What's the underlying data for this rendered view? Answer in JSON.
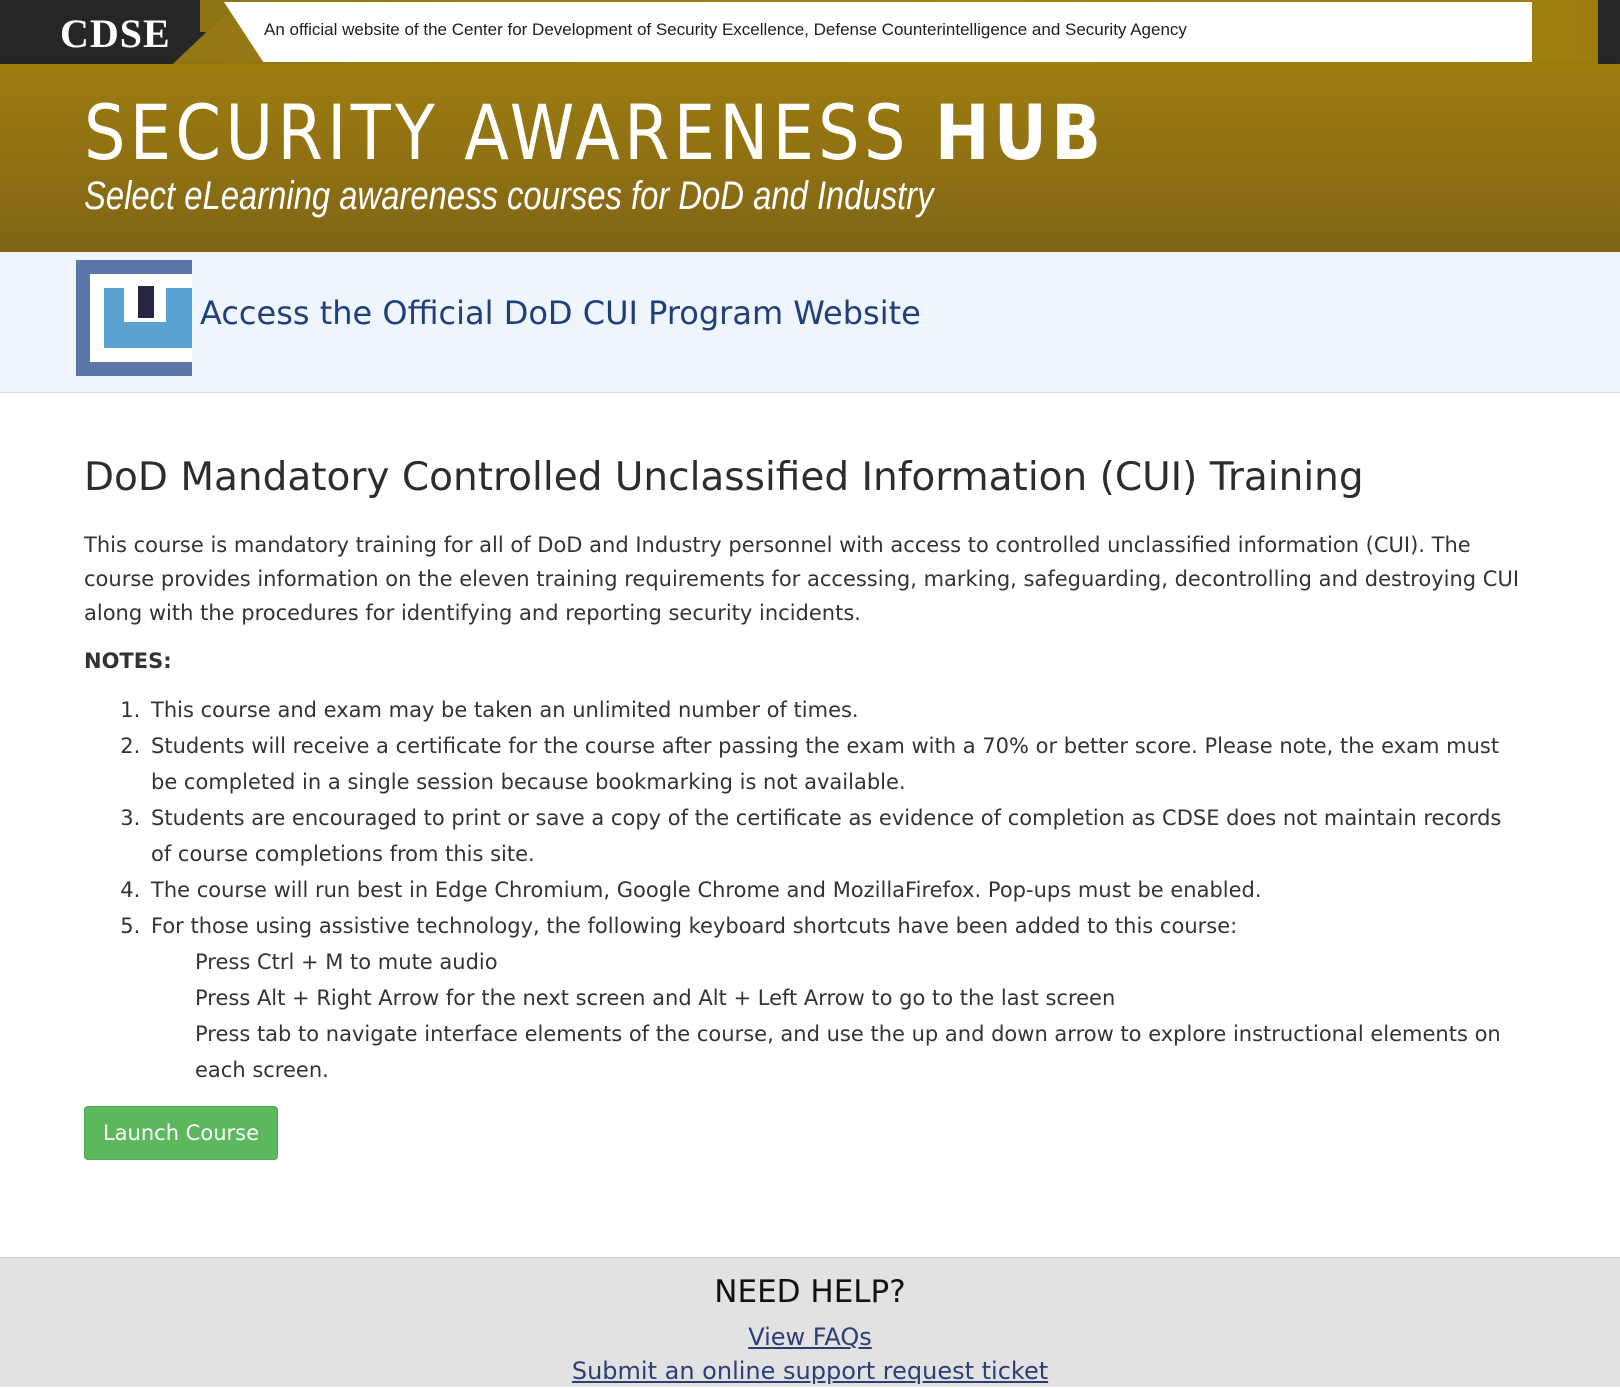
{
  "topbar": {
    "logo_text": "CDSE",
    "official_notice": "An official website of the Center for Development of Security Excellence, Defense Counterintelligence and Security Agency"
  },
  "hero": {
    "title_main": "SECURITY AWARENESS ",
    "title_bold": "HUB",
    "subtitle": "Select eLearning awareness courses for DoD and Industry"
  },
  "cui_band": {
    "logo_icon": "cui-program-logo-icon",
    "link_text": "Access the Official DoD CUI Program Website"
  },
  "main": {
    "title": "DoD Mandatory Controlled Unclassified Information (CUI) Training",
    "description": "This course is mandatory training for all of DoD and Industry personnel with access to controlled unclassified information (CUI). The course provides information on the eleven training requirements for accessing, marking, safeguarding, decontrolling and destroying CUI along with the procedures for identifying and reporting security incidents.",
    "notes_heading": "NOTES:",
    "notes": [
      "This course and exam may be taken an unlimited number of times.",
      "Students will receive a certificate for the course after passing the exam with a 70% or better score. Please note, the exam must be completed in a single session because bookmarking is not available.",
      "Students are encouraged to print or save a copy of the certificate as evidence of completion as CDSE does not maintain records of course completions from this site.",
      "The course will run best in Edge Chromium, Google Chrome and MozillaFirefox. Pop-ups must be enabled.",
      "For those using assistive technology, the following keyboard shortcuts have been added to this course:"
    ],
    "shortcuts": [
      "Press Ctrl + M to mute audio",
      "Press Alt + Right Arrow for the next screen and Alt + Left Arrow to go to the last screen",
      "Press tab to navigate interface elements of the course, and use the up and down arrow to explore instructional elements on each screen."
    ],
    "launch_label": "Launch Course"
  },
  "help": {
    "title": "NEED HELP?",
    "faq_link": "View FAQs",
    "ticket_link": "Submit an online support request ticket"
  },
  "colors": {
    "gold": "#9d7c0f",
    "dark": "#262626",
    "link_blue": "#1f3f7a",
    "button_green": "#5cb85c",
    "band_blue": "#eef5fc"
  }
}
